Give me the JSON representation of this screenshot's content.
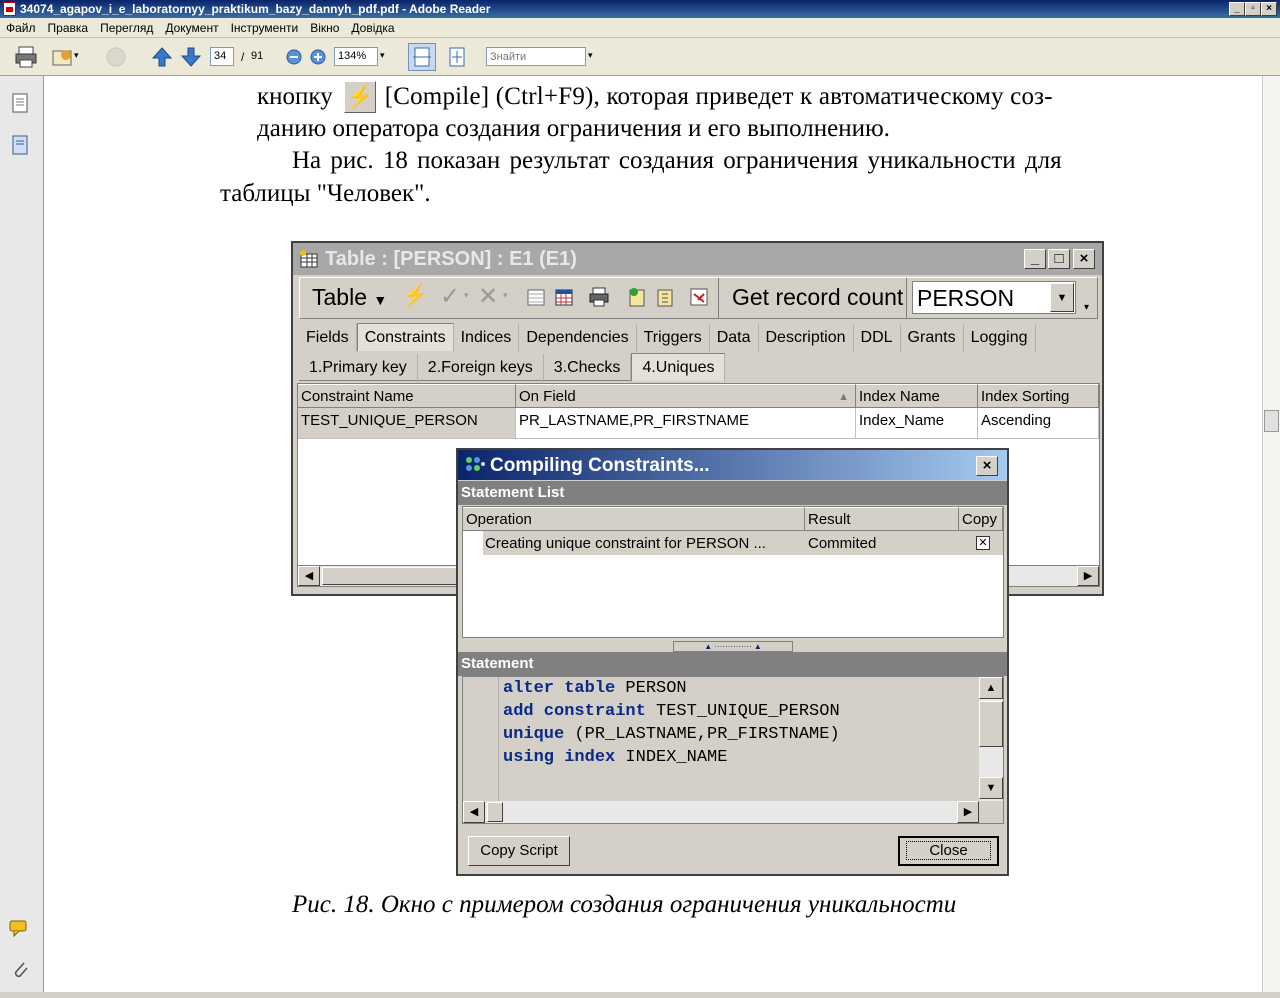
{
  "app": {
    "title": "34074_agapov_i_e_laboratornyy_praktikum_bazy_dannyh_pdf.pdf - Adobe Reader",
    "menu": [
      "Файл",
      "Правка",
      "Перегляд",
      "Документ",
      "Інструменти",
      "Вікно",
      "Довідка"
    ],
    "page_current": "34",
    "page_sep": "/",
    "page_total": "91",
    "zoom": "134%",
    "search_placeholder": "Знайти"
  },
  "doc": {
    "line1_a": "кнопку",
    "line1_b": "[Compile] (Ctrl+F9), которая приведет к автоматическому соз-",
    "line2": "данию оператора создания ограничения и его выполнению.",
    "line3": "На рис. 18 показан результат создания ограничения уникальности для",
    "line4": "таблицы \"Человек\".",
    "caption": "Рис. 18. Окно с примером создания ограничения уникальности"
  },
  "table_window": {
    "title": "Table : [PERSON] : E1 (E1)",
    "table_btn": "Table",
    "record_count_btn": "Get record count",
    "table_select": "PERSON",
    "tabs": [
      "Fields",
      "Constraints",
      "Indices",
      "Dependencies",
      "Triggers",
      "Data",
      "Description",
      "DDL",
      "Grants",
      "Logging"
    ],
    "subtabs": [
      "1.Primary key",
      "2.Foreign keys",
      "3.Checks",
      "4.Uniques"
    ],
    "columns": [
      "Constraint Name",
      "On Field",
      "Index Name",
      "Index Sorting"
    ],
    "rows": [
      [
        "TEST_UNIQUE_PERSON",
        "PR_LASTNAME,PR_FIRSTNAME",
        "Index_Name",
        "Ascending"
      ]
    ]
  },
  "dialog": {
    "title": "Compiling Constraints...",
    "statement_list_label": "Statement List",
    "columns": [
      "Operation",
      "Result",
      "Copy"
    ],
    "rows": [
      {
        "operation": "Creating unique constraint for PERSON ...",
        "result": "Commited"
      }
    ],
    "statement_label": "Statement",
    "code": [
      {
        "kw": "alter table",
        "rest": "PERSON"
      },
      {
        "kw": "add constraint",
        "rest": "TEST_UNIQUE_PERSON"
      },
      {
        "kw": "unique",
        "rest": "(PR_LASTNAME,PR_FIRSTNAME)"
      },
      {
        "kw": "using index",
        "rest": "INDEX_NAME"
      }
    ],
    "copy_script_btn": "Copy Script",
    "close_btn": "Close"
  }
}
